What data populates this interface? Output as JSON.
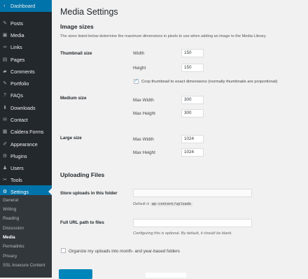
{
  "sidebar": {
    "items": [
      {
        "label": "Dashboard",
        "icon": "dashboard-icon",
        "glyph": "◐"
      },
      {
        "label": "Posts",
        "icon": "pin-icon",
        "glyph": "✎"
      },
      {
        "label": "Media",
        "icon": "media-icon",
        "glyph": "▣"
      },
      {
        "label": "Links",
        "icon": "link-icon",
        "glyph": "∞"
      },
      {
        "label": "Pages",
        "icon": "pages-icon",
        "glyph": "▤"
      },
      {
        "label": "Comments",
        "icon": "comments-icon",
        "glyph": "▰"
      },
      {
        "label": "Portfolio",
        "icon": "portfolio-icon",
        "glyph": "✎"
      },
      {
        "label": "FAQs",
        "icon": "faq-icon",
        "glyph": "?"
      },
      {
        "label": "Downloads",
        "icon": "download-icon",
        "glyph": "⬇"
      },
      {
        "label": "Contact",
        "icon": "mail-icon",
        "glyph": "✉"
      },
      {
        "label": "Caldera Forms",
        "icon": "forms-icon",
        "glyph": "▦"
      },
      {
        "label": "Appearance",
        "icon": "appearance-icon",
        "glyph": "✐"
      },
      {
        "label": "Plugins",
        "icon": "plugins-icon",
        "glyph": "⚙"
      },
      {
        "label": "Users",
        "icon": "users-icon",
        "glyph": "♟"
      },
      {
        "label": "Tools",
        "icon": "tools-icon",
        "glyph": "✂"
      },
      {
        "label": "Settings",
        "icon": "settings-icon",
        "glyph": "⚙"
      }
    ],
    "submenu": [
      "General",
      "Writing",
      "Reading",
      "Discussion",
      "Media",
      "Permalinks",
      "Privacy",
      "SSL Insecure Content"
    ]
  },
  "page": {
    "title": "Media Settings",
    "image_sizes_heading": "Image sizes",
    "description": "The sizes listed below determine the maximum dimensions in pixels to use when adding an image to the Media Library.",
    "thumbnail": {
      "label": "Thumbnail size",
      "width_label": "Width",
      "width": "150",
      "height_label": "Height",
      "height": "150",
      "crop_checked": "✓",
      "crop_label": "Crop thumbnail to exact dimensions (normally thumbnails are proportional)"
    },
    "medium": {
      "label": "Medium size",
      "max_width_label": "Max Width",
      "max_width": "300",
      "max_height_label": "Max Height",
      "max_height": "300"
    },
    "large": {
      "label": "Large size",
      "max_width_label": "Max Width",
      "max_width": "1024",
      "max_height_label": "Max Height",
      "max_height": "1024"
    },
    "uploading_heading": "Uploading Files",
    "store_label": "Store uploads in this folder",
    "store_value": "",
    "default_is": "Default is",
    "default_path": "wp-content/uploads",
    "full_url_label": "Full URL path to files",
    "full_url_value": "",
    "full_url_note": "Configuring this is optional. By default, it should be blank.",
    "organize_label": "Organize my uploads into month- and year-based folders"
  },
  "colors": {
    "sidebar": "#23282d",
    "active": "#0073aa",
    "accent": "#0085ba"
  }
}
